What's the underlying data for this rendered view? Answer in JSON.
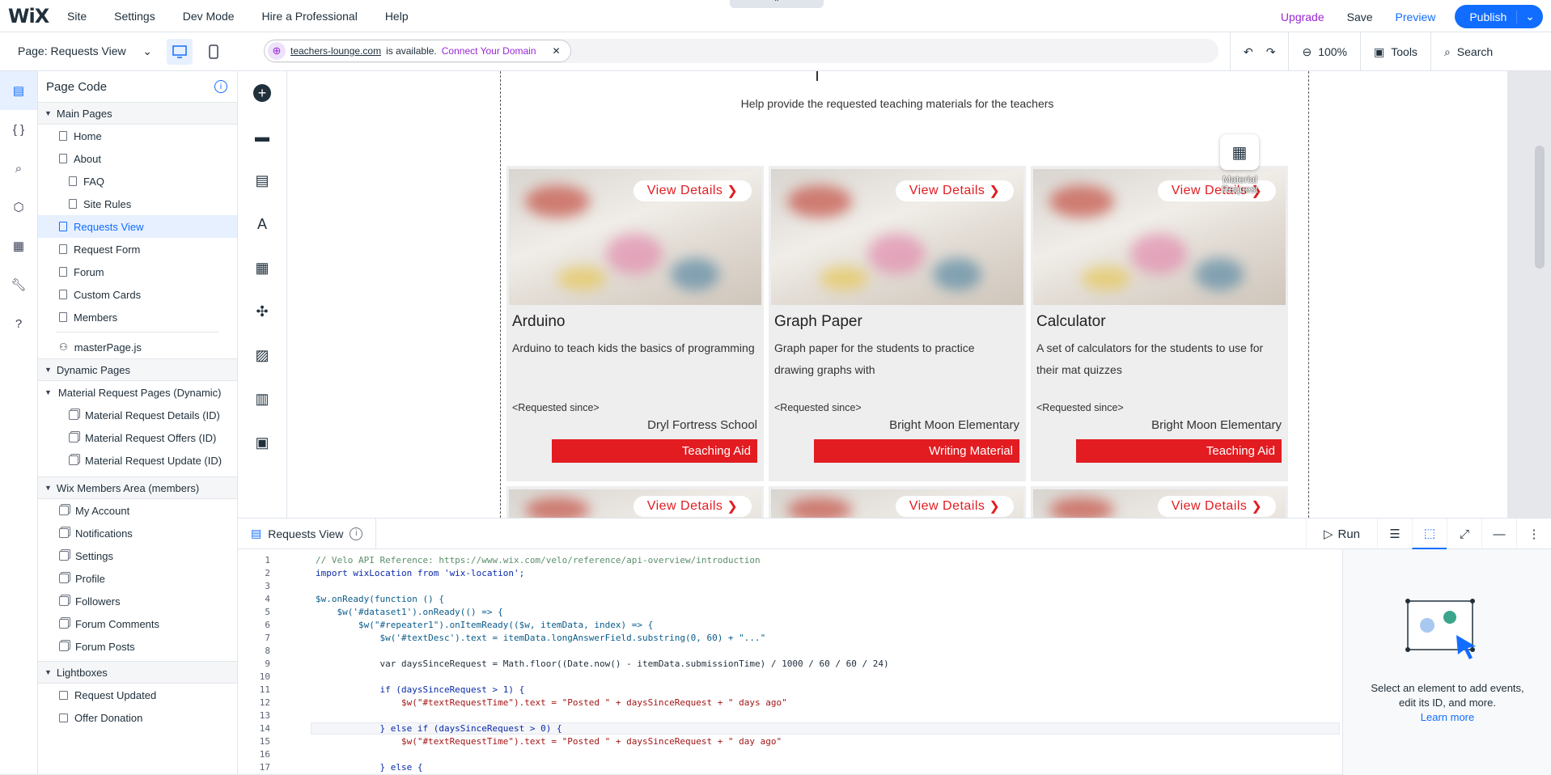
{
  "topbar": {
    "logo": "WiX",
    "menu": [
      "Site",
      "Settings",
      "Dev Mode",
      "Hire a Professional",
      "Help"
    ],
    "upgrade": "Upgrade",
    "save": "Save",
    "preview": "Preview",
    "publish": "Publish"
  },
  "toolbar": {
    "page_selector": "Page: Requests View",
    "domain_url": "teachers-lounge.com",
    "domain_status": "is available.",
    "domain_connect": "Connect Your Domain",
    "zoom": "100%",
    "tools": "Tools",
    "search": "Search"
  },
  "tree": {
    "title": "Page Code",
    "main_pages_title": "Main Pages",
    "main_pages": [
      "Home",
      "About",
      "FAQ",
      "Site Rules",
      "Requests View",
      "Request Form",
      "Forum",
      "Custom Cards",
      "Members"
    ],
    "master": "masterPage.js",
    "dynamic_title": "Dynamic Pages",
    "dynamic_group": "Material Request Pages (Dynamic)",
    "dynamic_pages": [
      "Material Request Details (ID)",
      "Material Request Offers (ID)",
      "Material Request Update (ID)"
    ],
    "members_title": "Wix Members Area (members)",
    "members_pages": [
      "My Account",
      "Notifications",
      "Settings",
      "Profile",
      "Followers",
      "Forum Comments",
      "Forum Posts"
    ],
    "lightboxes_title": "Lightboxes",
    "lightboxes": [
      "Request Updated",
      "Offer Donation"
    ]
  },
  "canvas": {
    "hint": "Help provide the requested teaching materials for the teachers",
    "dataset_label": "Material Request",
    "view_details": "View Details",
    "requested_since": "<Requested since>",
    "cards": [
      {
        "title": "Arduino",
        "desc": "Arduino to teach kids the basics of programming",
        "school": "Dryl Fortress School",
        "tag": "Teaching Aid"
      },
      {
        "title": "Graph Paper",
        "desc": "Graph paper for the students to practice drawing graphs with",
        "school": "Bright Moon Elementary",
        "tag": "Writing Material"
      },
      {
        "title": "Calculator",
        "desc": "A set of calculators for the students to use for their mat quizzes",
        "school": "Bright Moon Elementary",
        "tag": "Teaching Aid"
      }
    ]
  },
  "code_panel": {
    "tab": "Requests View",
    "run": "Run",
    "side_text_1": "Select an element to add events,",
    "side_text_2": "edit its ID, and more.",
    "side_link": "Learn more"
  },
  "code": {
    "lines": [
      "// Velo API Reference: https://www.wix.com/velo/reference/api-overview/introduction",
      "import wixLocation from 'wix-location';",
      "",
      "$w.onReady(function () {",
      "    $w('#dataset1').onReady(() => {",
      "        $w(\"#repeater1\").onItemReady(($w, itemData, index) => {",
      "            $w('#textDesc').text = itemData.longAnswerField.substring(0, 60) + \"...\"",
      "",
      "            var daysSinceRequest = Math.floor((Date.now() - itemData.submissionTime) / 1000 / 60 / 60 / 24)",
      "",
      "            if (daysSinceRequest > 1) {",
      "                $w(\"#textRequestTime\").text = \"Posted \" + daysSinceRequest + \" days ago\"",
      "",
      "            } else if (daysSinceRequest > 0) {",
      "                $w(\"#textRequestTime\").text = \"Posted \" + daysSinceRequest + \" day ago\"",
      "",
      "            } else {"
    ],
    "line_numbers": [
      "1",
      "2",
      "3",
      "4",
      "5",
      "6",
      "7",
      "8",
      "9",
      "10",
      "11",
      "12",
      "13",
      "14",
      "15",
      "16",
      "17"
    ]
  },
  "icons": {
    "rail": [
      "page-code-icon",
      "braces-icon",
      "search-icon",
      "package-icon",
      "database-icon",
      "wrench-icon",
      "help-icon"
    ],
    "add": [
      "add-icon",
      "section-icon",
      "page-icon",
      "design-icon",
      "apps-icon",
      "puzzle-icon",
      "media-icon",
      "table-icon",
      "business-icon"
    ]
  },
  "colors": {
    "accent": "#116dff",
    "upgrade": "#9a27d5",
    "tag_red": "#e21c21"
  }
}
